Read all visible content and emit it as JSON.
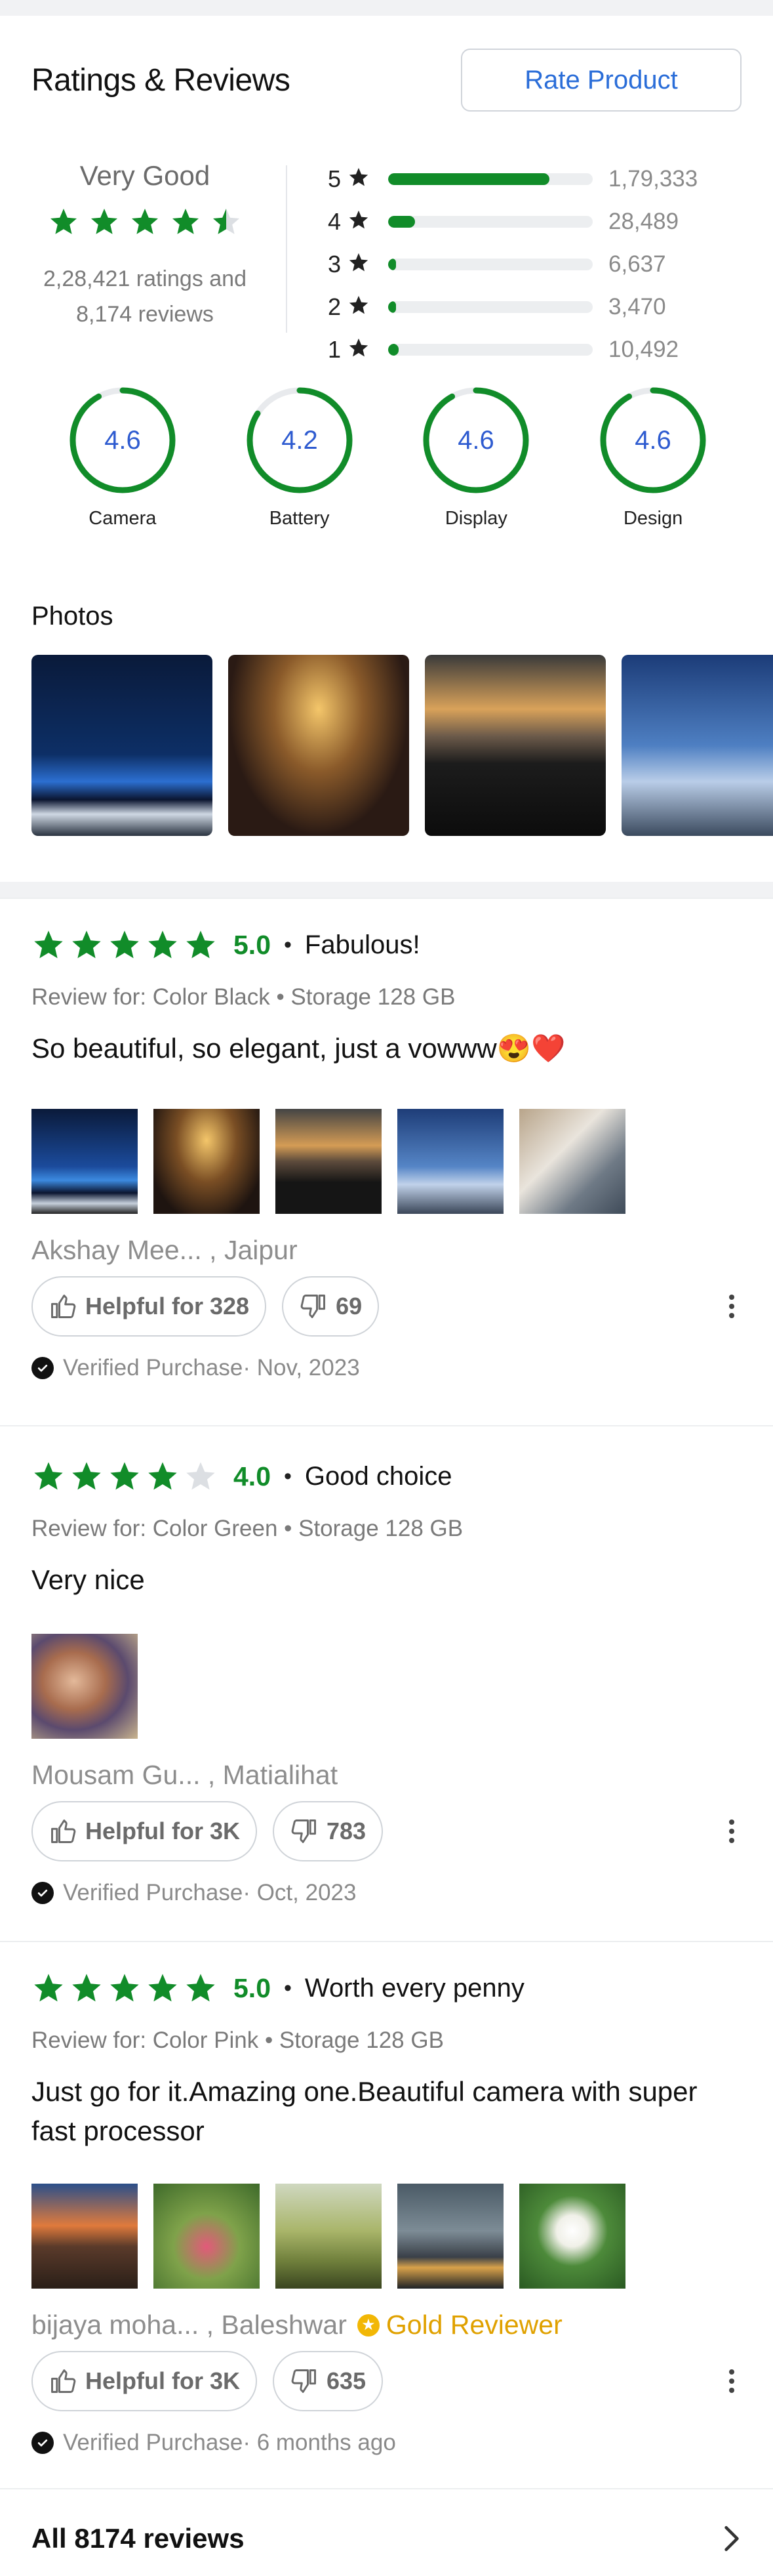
{
  "header": {
    "title": "Ratings & Reviews",
    "rate_button": "Rate Product"
  },
  "overview": {
    "label": "Very Good",
    "rating_value": 4.5,
    "ratings_line": "2,28,421 ratings and",
    "reviews_line": "8,174 reviews",
    "distribution": [
      {
        "star": "5",
        "count": "1,79,333",
        "fraction": 0.79
      },
      {
        "star": "4",
        "count": "28,489",
        "fraction": 0.13
      },
      {
        "star": "3",
        "count": "6,637",
        "fraction": 0.03
      },
      {
        "star": "2",
        "count": "3,470",
        "fraction": 0.02
      },
      {
        "star": "1",
        "count": "10,492",
        "fraction": 0.05
      }
    ]
  },
  "features": [
    {
      "score": "4.6",
      "label": "Camera",
      "fraction": 0.92
    },
    {
      "score": "4.2",
      "label": "Battery",
      "fraction": 0.84
    },
    {
      "score": "4.6",
      "label": "Display",
      "fraction": 0.92
    },
    {
      "score": "4.6",
      "label": "Design",
      "fraction": 0.92
    }
  ],
  "photos": {
    "title": "Photos"
  },
  "reviews": [
    {
      "score": "5.0",
      "stars": 5,
      "title": "Fabulous!",
      "review_for": "Review for: Color Black • Storage 128 GB",
      "body": "So beautiful, so elegant, just a vowww😍❤️",
      "author": "Akshay Mee... , Jaipur",
      "helpful": "Helpful for 328",
      "dislikes": "69",
      "verified": "Verified Purchase· Nov, 2023"
    },
    {
      "score": "4.0",
      "stars": 4,
      "title": "Good choice",
      "review_for": "Review for: Color Green • Storage 128 GB",
      "body": "Very nice",
      "author": "Mousam Gu...  , Matialihat",
      "helpful": "Helpful for 3K",
      "dislikes": "783",
      "verified": "Verified Purchase· Oct, 2023"
    },
    {
      "score": "5.0",
      "stars": 5,
      "title": "Worth every penny",
      "review_for": "Review for: Color Pink • Storage 128 GB",
      "body": "Just go for it.Amazing one.Beautiful camera with super fast processor",
      "author": "bijaya moha... , Baleshwar",
      "badge": "Gold Reviewer",
      "helpful": "Helpful for 3K",
      "dislikes": "635",
      "verified": "Verified Purchase· 6 months ago"
    }
  ],
  "footer": {
    "all_reviews": "All 8174 reviews"
  },
  "colors": {
    "green": "#118c29",
    "blue": "#2a6dd8",
    "gold": "#e0a100"
  }
}
